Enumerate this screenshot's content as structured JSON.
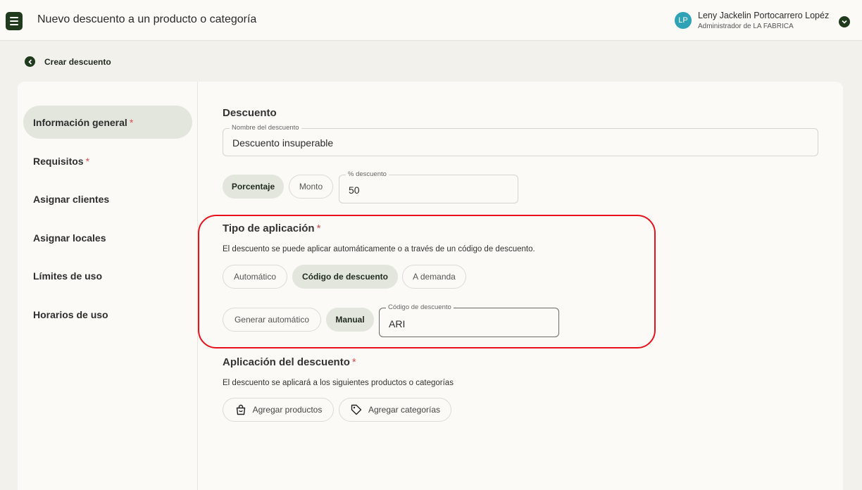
{
  "header": {
    "title": "Nuevo descuento a un producto o categoría",
    "user": {
      "initials": "LP",
      "name": "Leny Jackelin Portocarrero Lopéz",
      "role": "Administrador de LA FABRICA"
    }
  },
  "back": {
    "label": "Crear descuento"
  },
  "sidebar": {
    "items": [
      {
        "label": "Información general",
        "required": "*",
        "active": true
      },
      {
        "label": "Requisitos",
        "required": "*"
      },
      {
        "label": "Asignar clientes"
      },
      {
        "label": "Asignar locales"
      },
      {
        "label": "Límites de uso"
      },
      {
        "label": "Horarios de uso"
      }
    ]
  },
  "descuento": {
    "title": "Descuento",
    "name_field": {
      "label": "Nombre del descuento",
      "value": "Descuento insuperable"
    },
    "type_options": [
      "Porcentaje",
      "Monto"
    ],
    "selected_type": "Porcentaje",
    "percent_field": {
      "label": "% descuento",
      "value": "50"
    }
  },
  "aplicacion": {
    "title": "Tipo de aplicación",
    "required": "*",
    "description": "El descuento se puede aplicar automáticamente o a través de un código de descuento.",
    "options": [
      "Automático",
      "Código de descuento",
      "A demanda"
    ],
    "selected": "Código de descuento",
    "code_modes": [
      "Generar automático",
      "Manual"
    ],
    "selected_mode": "Manual",
    "code_field": {
      "label": "Código de descuento",
      "value": "ARI"
    }
  },
  "aplicacion_descuento": {
    "title": "Aplicación del descuento",
    "required": "*",
    "description": "El descuento se aplicará a los siguientes productos o categorías",
    "add_products": "Agregar productos",
    "add_categories": "Agregar categorías"
  },
  "colors": {
    "brand": "#1f3a1c",
    "selected_chip": "#e2e6dc",
    "highlight": "#e8121c",
    "avatar": "#2fa3b5",
    "required": "#e04b4b"
  }
}
